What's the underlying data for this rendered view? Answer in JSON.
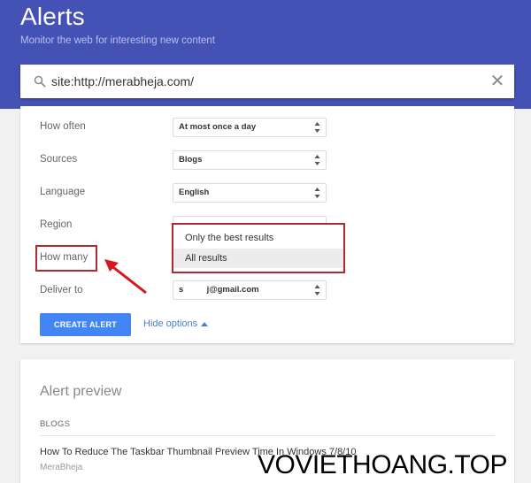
{
  "header": {
    "title": "Alerts",
    "subtitle": "Monitor the web for interesting new content",
    "background_color": "#4452b5"
  },
  "search": {
    "icon": "search-icon",
    "value": "site:http://merabheja.com/",
    "clear_icon": "close-icon",
    "clear_glyph": "✕"
  },
  "options": {
    "rows": [
      {
        "label": "How often",
        "value": "At most once a day"
      },
      {
        "label": "Sources",
        "value": "Blogs"
      },
      {
        "label": "Language",
        "value": "English"
      },
      {
        "label": "Region",
        "value": ""
      },
      {
        "label": "How many",
        "value": ""
      },
      {
        "label": "Deliver to",
        "value": "s          j@gmail.com"
      }
    ],
    "how_many_dropdown": {
      "options": [
        "Only the best results",
        "All results"
      ],
      "highlighted": "All results"
    },
    "create_button": "CREATE ALERT",
    "hide_options": "Hide options",
    "accent_color": "#4285f4",
    "annotation_color": "#b3282e"
  },
  "preview": {
    "title": "Alert preview",
    "section": "BLOGS",
    "results": [
      {
        "title": "How To Reduce The Taskbar Thumbnail Preview Time In Windows 7/8/10",
        "source": "MeraBheja"
      }
    ]
  },
  "watermark": "VOVIETHOANG.TOP"
}
